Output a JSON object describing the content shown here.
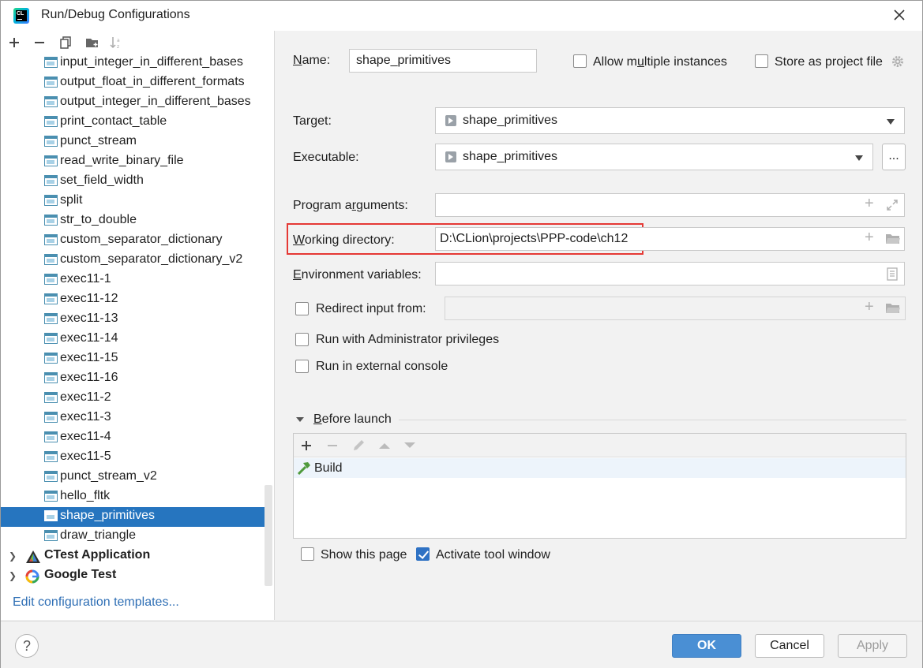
{
  "window": {
    "title": "Run/Debug Configurations",
    "logo_text": "CL"
  },
  "left": {
    "toolbar": [
      "add-icon",
      "remove-icon",
      "copy-icon",
      "folder-add-icon",
      "sort-icon"
    ],
    "items": [
      "input_integer_in_different_bases",
      "output_float_in_different_formats",
      "output_integer_in_different_bases",
      "print_contact_table",
      "punct_stream",
      "read_write_binary_file",
      "set_field_width",
      "split",
      "str_to_double",
      "custom_separator_dictionary",
      "custom_separator_dictionary_v2",
      "exec11-1",
      "exec11-12",
      "exec11-13",
      "exec11-14",
      "exec11-15",
      "exec11-16",
      "exec11-2",
      "exec11-3",
      "exec11-4",
      "exec11-5",
      "punct_stream_v2",
      "hello_fltk",
      "shape_primitives",
      "draw_triangle"
    ],
    "selected": "shape_primitives",
    "groups": [
      {
        "label": "CTest Application",
        "icon": "ctest-icon"
      },
      {
        "label": "Google Test",
        "icon": "google-test-icon"
      }
    ],
    "edit_templates": "Edit configuration templates..."
  },
  "form": {
    "name_label_u": "N",
    "name_label_rest": "ame:",
    "name_value": "shape_primitives",
    "allow_multi_a": "Allow m",
    "allow_multi_u": "u",
    "allow_multi_b": "ltiple instances",
    "store_label": "Store as project file",
    "target_label": "Target:",
    "target_value": "shape_primitives",
    "executable_label": "Executable:",
    "executable_value": "shape_primitives",
    "browse_label": "...",
    "program_args_a": "Program a",
    "program_args_u": "r",
    "program_args_b": "guments:",
    "workdir_u": "W",
    "workdir_rest": "orking directory:",
    "workdir_value": "D:\\CLion\\projects\\PPP-code\\ch12",
    "env_u": "E",
    "env_rest": "nvironment variables:",
    "redirect_label": "Redirect input from:",
    "run_admin_label": "Run with Administrator privileges",
    "run_external_label": "Run in external console"
  },
  "before_launch": {
    "title_u": "B",
    "title_rest": "efore launch",
    "task": "Build",
    "show_page": "Show this page",
    "activate_window": "Activate tool window"
  },
  "buttons": {
    "help": "?",
    "ok": "OK",
    "cancel": "Cancel",
    "apply": "Apply"
  },
  "colors": {
    "selection": "#2675bf",
    "accent": "#4a8fd4",
    "highlight_border": "#e53935",
    "link": "#2f6fb5"
  }
}
